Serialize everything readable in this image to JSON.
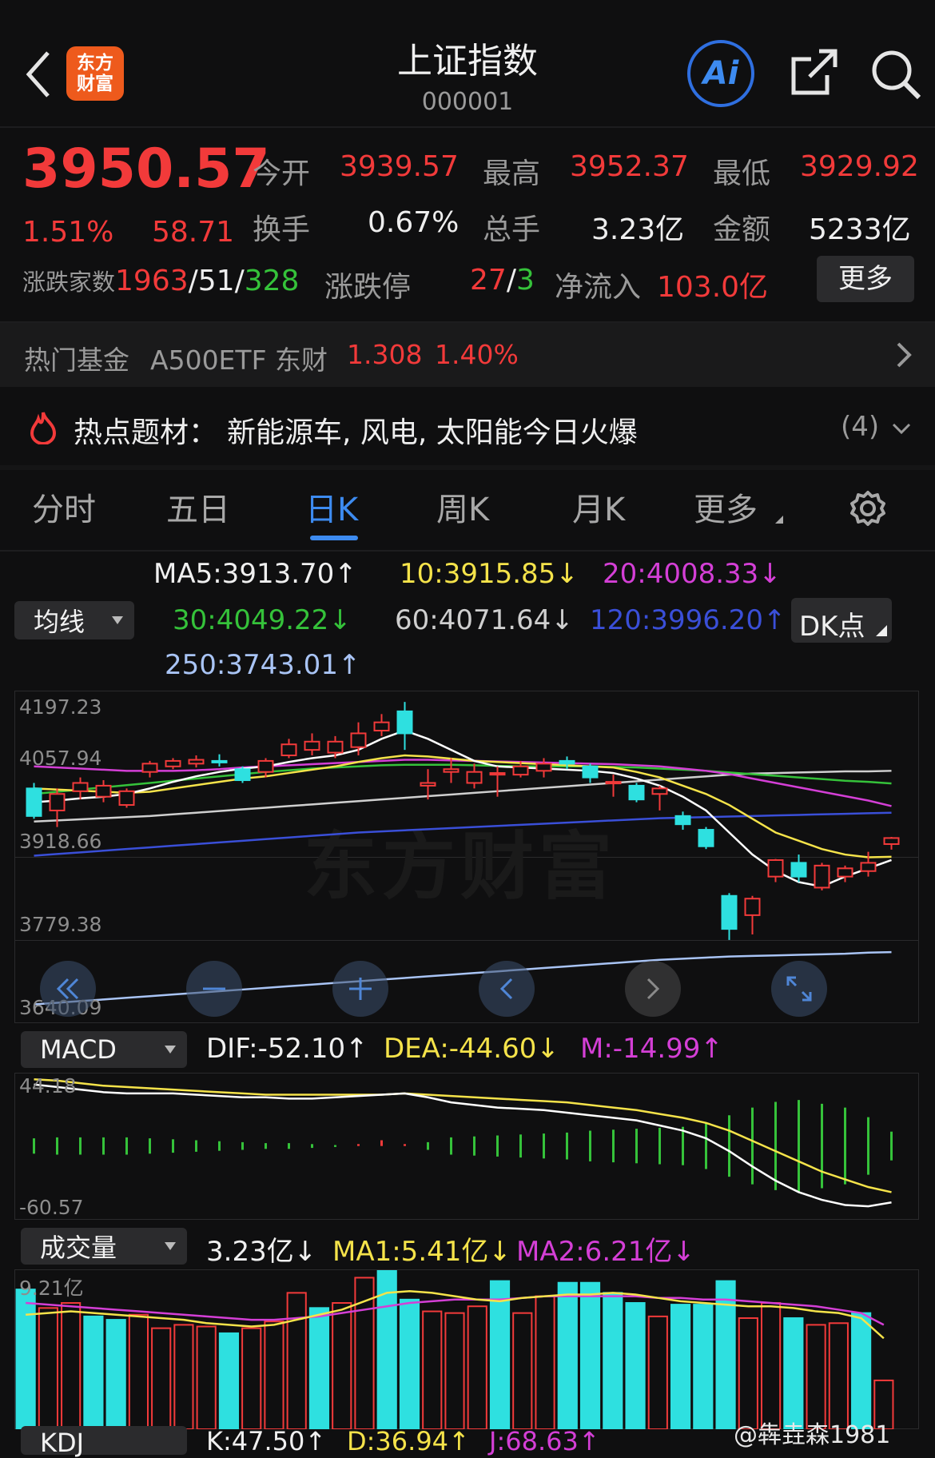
{
  "header": {
    "back_label": "<",
    "logo_text": "东方\n财富",
    "title": "上证指数",
    "code": "000001",
    "ai_label": "Ai"
  },
  "quote": {
    "price": "3950.57",
    "pct": "1.51%",
    "change": "58.71",
    "stats": [
      {
        "label": "今开",
        "value": "3939.57",
        "color": "red"
      },
      {
        "label": "最高",
        "value": "3952.37",
        "color": "red"
      },
      {
        "label": "最低",
        "value": "3929.92",
        "color": "red"
      },
      {
        "label": "换手",
        "value": "0.67%",
        "color": "white"
      },
      {
        "label": "总手",
        "value": "3.23亿",
        "color": "white"
      },
      {
        "label": "金额",
        "value": "5233亿",
        "color": "white"
      }
    ],
    "breadth_label": "涨跌家数",
    "up_count": "1963",
    "flat_count": "51",
    "down_count": "328",
    "limit_label": "涨跌停",
    "limit_up": "27",
    "limit_down": "3",
    "netflow_label": "净流入",
    "netflow_value": "103.0亿",
    "more_button": "更多"
  },
  "fund_bar": {
    "label": "热门基金",
    "name": "A500ETF 东财",
    "price": "1.308",
    "pct": "1.40%"
  },
  "hot_topic": {
    "label": "热点题材：",
    "text": "新能源车, 风电, 太阳能今日火爆",
    "count": "(4)"
  },
  "tabs": [
    "分时",
    "五日",
    "日K",
    "周K",
    "月K",
    "更多"
  ],
  "active_tab": "日K",
  "ma_panel": {
    "dropdown": "均线",
    "ma5": "MA5:3913.70↑",
    "ma10": "10:3915.85↓",
    "ma20": "20:4008.33↓",
    "ma30": "30:4049.22↓",
    "ma60": "60:4071.64↓",
    "ma120": "120:3996.20↑",
    "ma250": "250:3743.01↑",
    "dk_button": "DK点"
  },
  "kline_axis": [
    "4197.23",
    "4057.94",
    "3918.66",
    "3779.38",
    "3640.09"
  ],
  "watermark": "东方财富",
  "macd_panel": {
    "dropdown": "MACD",
    "dif": "DIF:-52.10↑",
    "dea": "DEA:-44.60↓",
    "m": "M:-14.99↑",
    "axis_top": "44.18",
    "axis_bottom": "-60.57"
  },
  "volume_panel": {
    "dropdown": "成交量",
    "vol": "3.23亿↓",
    "ma1": "MA1:5.41亿↓",
    "ma2": "MA2:6.21亿↓",
    "axis_top": "9.21亿"
  },
  "kdj_panel": {
    "dropdown": "KDJ",
    "k": "K:47.50↑",
    "d": "D:36.94↑",
    "j": "J:68.63↑"
  },
  "weibo_watermark": "@犇垚森1981",
  "colors": {
    "up": "#f23a3a",
    "down": "#2ee0e0",
    "accent": "#3d8bf0",
    "ma5": "#ffffff",
    "ma10": "#f5e34a",
    "ma20": "#d43fd6",
    "ma30": "#35c23a",
    "ma60": "#cfcfcf",
    "ma120": "#3a4fd8",
    "ma250": "#a9c4f5"
  },
  "chart_data": {
    "type": "candlestick",
    "note_y_range": [
      3640.09,
      4197.23
    ],
    "candles": [
      {
        "o": 4040,
        "c": 3990,
        "h": 4050,
        "l": 3985
      },
      {
        "o": 4000,
        "c": 4030,
        "h": 4040,
        "l": 3970
      },
      {
        "o": 4035,
        "c": 4050,
        "h": 4060,
        "l": 4020
      },
      {
        "o": 4025,
        "c": 4045,
        "h": 4055,
        "l": 4015
      },
      {
        "o": 4010,
        "c": 4035,
        "h": 4040,
        "l": 4005
      },
      {
        "o": 4070,
        "c": 4085,
        "h": 4090,
        "l": 4060
      },
      {
        "o": 4080,
        "c": 4090,
        "h": 4095,
        "l": 4075
      },
      {
        "o": 4085,
        "c": 4092,
        "h": 4100,
        "l": 4078
      },
      {
        "o": 4090,
        "c": 4088,
        "h": 4102,
        "l": 4080
      },
      {
        "o": 4075,
        "c": 4055,
        "h": 4080,
        "l": 4050
      },
      {
        "o": 4070,
        "c": 4090,
        "h": 4095,
        "l": 4060
      },
      {
        "o": 4100,
        "c": 4120,
        "h": 4130,
        "l": 4095
      },
      {
        "o": 4110,
        "c": 4125,
        "h": 4140,
        "l": 4100
      },
      {
        "o": 4105,
        "c": 4125,
        "h": 4135,
        "l": 4095
      },
      {
        "o": 4115,
        "c": 4140,
        "h": 4160,
        "l": 4100
      },
      {
        "o": 4145,
        "c": 4160,
        "h": 4175,
        "l": 4135
      },
      {
        "o": 4180,
        "c": 4140,
        "h": 4197,
        "l": 4110
      },
      {
        "o": 4045,
        "c": 4050,
        "h": 4075,
        "l": 4020
      },
      {
        "o": 4070,
        "c": 4075,
        "h": 4095,
        "l": 4050
      },
      {
        "o": 4050,
        "c": 4070,
        "h": 4085,
        "l": 4040
      },
      {
        "o": 4065,
        "c": 4068,
        "h": 4080,
        "l": 4025
      },
      {
        "o": 4065,
        "c": 4080,
        "h": 4090,
        "l": 4060
      },
      {
        "o": 4072,
        "c": 4085,
        "h": 4095,
        "l": 4060
      },
      {
        "o": 4090,
        "c": 4085,
        "h": 4098,
        "l": 4075
      },
      {
        "o": 4080,
        "c": 4060,
        "h": 4085,
        "l": 4050
      },
      {
        "o": 4050,
        "c": 4052,
        "h": 4065,
        "l": 4025
      },
      {
        "o": 4045,
        "c": 4020,
        "h": 4050,
        "l": 4015
      },
      {
        "o": 4030,
        "c": 4040,
        "h": 4045,
        "l": 4000
      },
      {
        "o": 3990,
        "c": 3975,
        "h": 3998,
        "l": 3965
      },
      {
        "o": 3965,
        "c": 3935,
        "h": 3970,
        "l": 3930
      },
      {
        "o": 3845,
        "c": 3785,
        "h": 3850,
        "l": 3765
      },
      {
        "o": 3810,
        "c": 3840,
        "h": 3845,
        "l": 3775
      },
      {
        "o": 3880,
        "c": 3910,
        "h": 3912,
        "l": 3870
      },
      {
        "o": 3905,
        "c": 3880,
        "h": 3920,
        "l": 3870
      },
      {
        "o": 3860,
        "c": 3900,
        "h": 3905,
        "l": 3855
      },
      {
        "o": 3880,
        "c": 3895,
        "h": 3900,
        "l": 3870
      },
      {
        "o": 3890,
        "c": 3905,
        "h": 3925,
        "l": 3880
      },
      {
        "o": 3939,
        "c": 3950,
        "h": 3952,
        "l": 3929
      }
    ],
    "ma5": [
      4015,
      4018,
      4022,
      4025,
      4030,
      4040,
      4052,
      4062,
      4070,
      4076,
      4080,
      4088,
      4095,
      4100,
      4110,
      4130,
      4145,
      4130,
      4110,
      4090,
      4080,
      4078,
      4076,
      4074,
      4072,
      4068,
      4058,
      4045,
      4025,
      4000,
      3960,
      3920,
      3890,
      3870,
      3862,
      3880,
      3895,
      3910
    ],
    "ma10": [
      4040,
      4038,
      4036,
      4034,
      4032,
      4034,
      4040,
      4046,
      4052,
      4058,
      4062,
      4068,
      4074,
      4080,
      4088,
      4095,
      4100,
      4098,
      4094,
      4090,
      4088,
      4086,
      4084,
      4082,
      4080,
      4078,
      4070,
      4060,
      4045,
      4030,
      4010,
      3985,
      3960,
      3945,
      3930,
      3920,
      3915,
      3916
    ],
    "ma20": [
      4080,
      4078,
      4076,
      4074,
      4072,
      4072,
      4072,
      4073,
      4075,
      4078,
      4080,
      4082,
      4084,
      4086,
      4088,
      4090,
      4092,
      4092,
      4091,
      4090,
      4089,
      4088,
      4087,
      4086,
      4085,
      4084,
      4082,
      4080,
      4076,
      4072,
      4066,
      4058,
      4050,
      4042,
      4034,
      4026,
      4018,
      4008
    ],
    "ma30": [
      4030,
      4034,
      4038,
      4042,
      4046,
      4050,
      4054,
      4058,
      4062,
      4066,
      4070,
      4073,
      4076,
      4078,
      4080,
      4082,
      4083,
      4083,
      4083,
      4082,
      4081,
      4080,
      4080,
      4080,
      4080,
      4079,
      4078,
      4076,
      4074,
      4072,
      4069,
      4066,
      4063,
      4060,
      4057,
      4054,
      4052,
      4049
    ],
    "ma60": [
      3980,
      3982,
      3984,
      3986,
      3988,
      3990,
      3993,
      3996,
      3999,
      4002,
      4005,
      4008,
      4011,
      4014,
      4017,
      4020,
      4023,
      4026,
      4029,
      4032,
      4035,
      4038,
      4041,
      4044,
      4047,
      4050,
      4053,
      4056,
      4059,
      4062,
      4065,
      4067,
      4068,
      4069,
      4070,
      4071,
      4071,
      4072
    ],
    "ma120": [
      3918,
      3921,
      3924,
      3927,
      3930,
      3933,
      3936,
      3939,
      3942,
      3945,
      3948,
      3951,
      3954,
      3957,
      3960,
      3962,
      3964,
      3966,
      3968,
      3970,
      3972,
      3974,
      3976,
      3978,
      3980,
      3982,
      3984,
      3986,
      3987,
      3988,
      3989,
      3990,
      3991,
      3992,
      3993,
      3994,
      3995,
      3996
    ],
    "ma250": [
      3648,
      3651,
      3654,
      3657,
      3660,
      3663,
      3666,
      3669,
      3672,
      3675,
      3678,
      3681,
      3684,
      3687,
      3690,
      3693,
      3696,
      3699,
      3702,
      3705,
      3708,
      3711,
      3714,
      3717,
      3720,
      3723,
      3726,
      3729,
      3731,
      3733,
      3735,
      3736,
      3737,
      3738,
      3739,
      3740,
      3742,
      3743
    ],
    "macd": {
      "y_range": [
        -60.57,
        44.18
      ],
      "dif": [
        40,
        38,
        36,
        34,
        33,
        33,
        33,
        32,
        31,
        30,
        30,
        29,
        29,
        30,
        31,
        32,
        33,
        30,
        26,
        24,
        22,
        21,
        20,
        18,
        16,
        14,
        12,
        8,
        4,
        -2,
        -12,
        -24,
        -35,
        -44,
        -50,
        -54,
        -55,
        -52
      ],
      "dea": [
        44,
        43,
        41,
        39,
        38,
        37,
        36,
        35,
        34,
        33,
        32,
        32,
        32,
        32,
        32,
        32,
        33,
        32,
        31,
        30,
        29,
        28,
        27,
        26,
        24,
        22,
        20,
        17,
        14,
        10,
        4,
        -4,
        -12,
        -20,
        -28,
        -34,
        -40,
        -44
      ],
      "m": [
        -8,
        -9,
        -9,
        -9,
        -9,
        -8,
        -7,
        -6,
        -5,
        -4,
        -3,
        -3,
        -2,
        -1,
        1,
        3,
        1,
        -4,
        -9,
        -10,
        -11,
        -12,
        -13,
        -14,
        -16,
        -17,
        -18,
        -19,
        -20,
        -24,
        -32,
        -40,
        -46,
        -48,
        -44,
        -40,
        -30,
        -15
      ]
    },
    "volume": {
      "y_max": 9.21,
      "values": [
        8.3,
        7.2,
        7.5,
        6.7,
        6.5,
        6.8,
        6.0,
        6.2,
        6.1,
        5.7,
        6.0,
        6.4,
        8.1,
        7.2,
        7.5,
        9.0,
        9.4,
        7.7,
        7.0,
        6.9,
        7.3,
        8.8,
        6.9,
        7.9,
        8.7,
        8.7,
        8.1,
        7.5,
        6.7,
        7.4,
        7.4,
        8.8,
        6.6,
        7.5,
        6.6,
        6.2,
        6.3,
        6.9,
        2.9
      ],
      "up": [
        false,
        true,
        true,
        false,
        false,
        true,
        true,
        true,
        true,
        false,
        true,
        true,
        true,
        false,
        true,
        true,
        false,
        false,
        true,
        true,
        true,
        false,
        true,
        true,
        false,
        false,
        false,
        false,
        true,
        false,
        false,
        false,
        true,
        true,
        false,
        true,
        true,
        false,
        true
      ],
      "ma1": [
        6.8,
        6.9,
        7.0,
        6.9,
        6.8,
        6.7,
        6.6,
        6.5,
        6.3,
        6.2,
        6.1,
        6.2,
        6.5,
        6.8,
        7.1,
        7.6,
        8.1,
        8.2,
        8.1,
        7.9,
        7.7,
        7.6,
        7.8,
        7.9,
        8.0,
        8.0,
        8.1,
        8.0,
        7.8,
        7.6,
        7.5,
        7.4,
        7.3,
        7.3,
        7.2,
        7.0,
        6.9,
        6.6,
        5.4
      ],
      "ma2": [
        7.5,
        7.4,
        7.3,
        7.2,
        7.1,
        7.0,
        6.9,
        6.8,
        6.7,
        6.6,
        6.5,
        6.5,
        6.6,
        6.7,
        6.9,
        7.1,
        7.3,
        7.5,
        7.6,
        7.7,
        7.7,
        7.7,
        7.8,
        7.9,
        7.9,
        7.9,
        7.9,
        7.9,
        7.8,
        7.8,
        7.7,
        7.7,
        7.6,
        7.5,
        7.4,
        7.3,
        7.1,
        6.9,
        6.2
      ]
    }
  }
}
